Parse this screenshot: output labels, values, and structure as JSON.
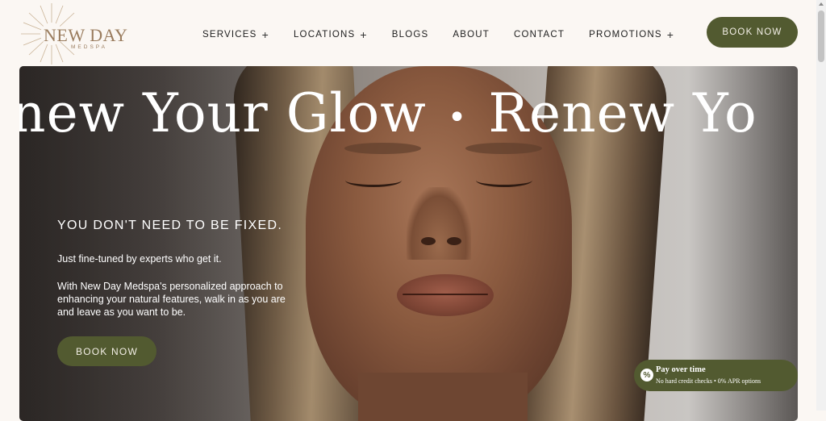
{
  "brand": {
    "name": "NEW DAY",
    "subtitle": "MEDSPA"
  },
  "nav": {
    "items": [
      {
        "label": "SERVICES",
        "expandable": true
      },
      {
        "label": "LOCATIONS",
        "expandable": true
      },
      {
        "label": "BLOGS",
        "expandable": false
      },
      {
        "label": "ABOUT",
        "expandable": false
      },
      {
        "label": "CONTACT",
        "expandable": false
      },
      {
        "label": "PROMOTIONS",
        "expandable": true
      }
    ],
    "plus_glyph": "+",
    "book_label": "BOOK NOW"
  },
  "hero": {
    "marquee_prefix": "enew Your Glow",
    "marquee_separator": "•",
    "marquee_text": "Renew Yo",
    "tagline": "YOU DON'T NEED TO BE FIXED.",
    "subline": "Just fine-tuned by experts who get it.",
    "body": "With New Day Medspa's personalized approach to enhancing your natural features, walk in as you are and leave as you want to be.",
    "cta_label": "BOOK NOW"
  },
  "financing": {
    "icon": "percent-icon",
    "icon_glyph": "%",
    "title": "Pay over time",
    "subtitle": "No hard credit checks • 0% APR options"
  },
  "colors": {
    "accent": "#525a30",
    "background": "#fbf7f3",
    "logo": "#9a7c5e"
  }
}
